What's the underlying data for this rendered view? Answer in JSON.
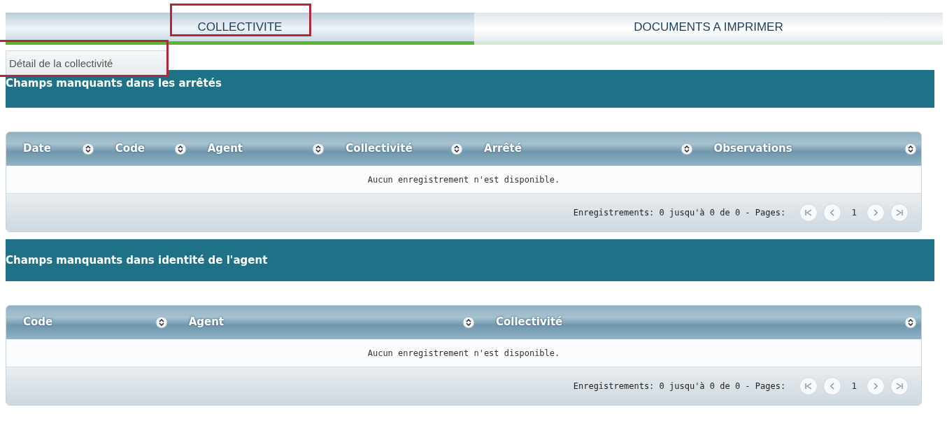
{
  "tabs": [
    {
      "label": "COLLECTIVITE",
      "selected": true
    },
    {
      "label": "DOCUMENTS A IMPRIMER",
      "selected": false
    }
  ],
  "subtab": {
    "label": "Détail de la collectivité"
  },
  "sections": [
    {
      "title": "Champs manquants dans les arrêtés",
      "grid": {
        "columns": [
          "Date",
          "Code",
          "Agent",
          "Collectivité",
          "Arrêté",
          "Observations"
        ],
        "empty_message": "Aucun enregistrement n'est disponible.",
        "pager": {
          "summary": "Enregistrements: 0 jusqu'à 0 de 0 - Pages:",
          "page": "1"
        }
      }
    },
    {
      "title": "Champs manquants dans identité de l'agent",
      "grid": {
        "columns": [
          "Code",
          "Agent",
          "Collectivité"
        ],
        "empty_message": "Aucun enregistrement n'est disponible.",
        "pager": {
          "summary": "Enregistrements: 0 jusqu'à 0 de 0 - Pages:",
          "page": "1"
        }
      }
    }
  ]
}
